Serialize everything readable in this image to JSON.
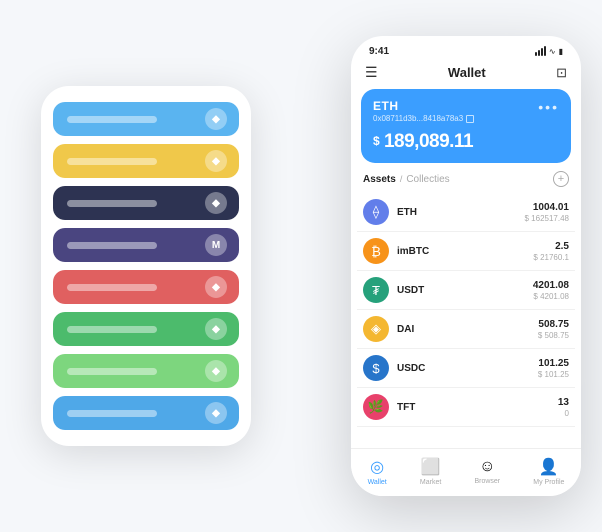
{
  "scene": {
    "background": "#f5f7fa"
  },
  "back_phone": {
    "cards": [
      {
        "color": "#5ab4f0",
        "icon": "◆"
      },
      {
        "color": "#f0c84a",
        "icon": "◆"
      },
      {
        "color": "#2d3352",
        "icon": "◆"
      },
      {
        "color": "#4a4580",
        "icon": "M"
      },
      {
        "color": "#e06060",
        "icon": "◆"
      },
      {
        "color": "#4cbb6c",
        "icon": "◆"
      },
      {
        "color": "#7dd67e",
        "icon": "◆"
      },
      {
        "color": "#4fa8e8",
        "icon": "◆"
      }
    ]
  },
  "front_phone": {
    "status_bar": {
      "time": "9:41"
    },
    "header": {
      "title": "Wallet"
    },
    "eth_card": {
      "label": "ETH",
      "address": "0x08711d3b...8418a78a3",
      "balance_symbol": "$",
      "balance": "189,089.11",
      "more_icon": "•••"
    },
    "assets_section": {
      "tab_active": "Assets",
      "tab_separator": "/",
      "tab_inactive": "Collecties"
    },
    "assets": [
      {
        "name": "ETH",
        "amount": "1004.01",
        "usd": "$ 162517.48",
        "icon_color": "#627eea",
        "icon_text": "⟠"
      },
      {
        "name": "imBTC",
        "amount": "2.5",
        "usd": "$ 21760.1",
        "icon_color": "#f7931a",
        "icon_text": "₿"
      },
      {
        "name": "USDT",
        "amount": "4201.08",
        "usd": "$ 4201.08",
        "icon_color": "#26a17b",
        "icon_text": "₮"
      },
      {
        "name": "DAI",
        "amount": "508.75",
        "usd": "$ 508.75",
        "icon_color": "#f4b731",
        "icon_text": "◈"
      },
      {
        "name": "USDC",
        "amount": "101.25",
        "usd": "$ 101.25",
        "icon_color": "#2775ca",
        "icon_text": "$"
      },
      {
        "name": "TFT",
        "amount": "13",
        "usd": "0",
        "icon_color": "#e8416b",
        "icon_text": "🌿"
      }
    ],
    "bottom_nav": [
      {
        "label": "Wallet",
        "icon": "◎",
        "active": true
      },
      {
        "label": "Market",
        "icon": "⬜",
        "active": false
      },
      {
        "label": "Browser",
        "icon": "☺",
        "active": false
      },
      {
        "label": "My Profile",
        "icon": "👤",
        "active": false
      }
    ]
  }
}
